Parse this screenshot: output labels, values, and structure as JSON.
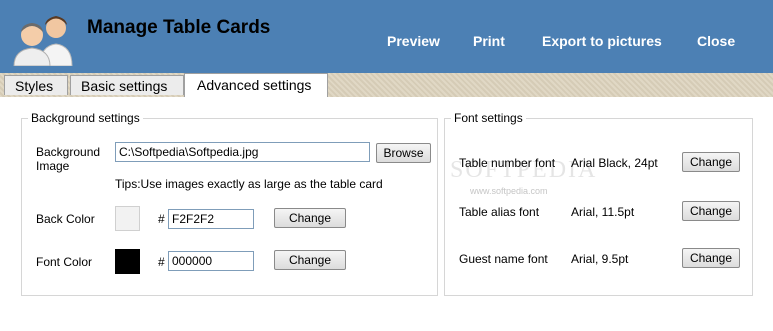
{
  "header": {
    "title": "Manage Table Cards",
    "nav": {
      "preview": "Preview",
      "print": "Print",
      "export": "Export to pictures",
      "close": "Close"
    },
    "colors": {
      "background": "#4c80b4",
      "nav_text": "#ffffff"
    }
  },
  "tabs": [
    {
      "label": "Styles"
    },
    {
      "label": "Basic settings"
    },
    {
      "label": "Advanced settings",
      "active": true
    }
  ],
  "background_settings": {
    "legend": "Background settings",
    "image_label_line1": "Background",
    "image_label_line2": "Image",
    "image_path": "C:\\Softpedia\\Softpedia.jpg",
    "browse_label": "Browse",
    "tip": "Tips:Use images exactly as large as the table card",
    "back_color_label": "Back Color",
    "back_color_hash": "#",
    "back_color_value": "F2F2F2",
    "back_color_swatch": "#f2f2f2",
    "font_color_label": "Font Color",
    "font_color_hash": "#",
    "font_color_value": "000000",
    "font_color_swatch": "#000000",
    "change_label": "Change"
  },
  "font_settings": {
    "legend": "Font settings",
    "change_label": "Change",
    "rows": [
      {
        "label": "Table number font",
        "value": "Arial Black, 24pt"
      },
      {
        "label": "Table alias font",
        "value": "Arial, 11.5pt"
      },
      {
        "label": "Guest name font",
        "value": "Arial, 9.5pt"
      }
    ]
  },
  "watermark": {
    "main": "SOFTPEDIA",
    "sub": "www.softpedia.com"
  }
}
